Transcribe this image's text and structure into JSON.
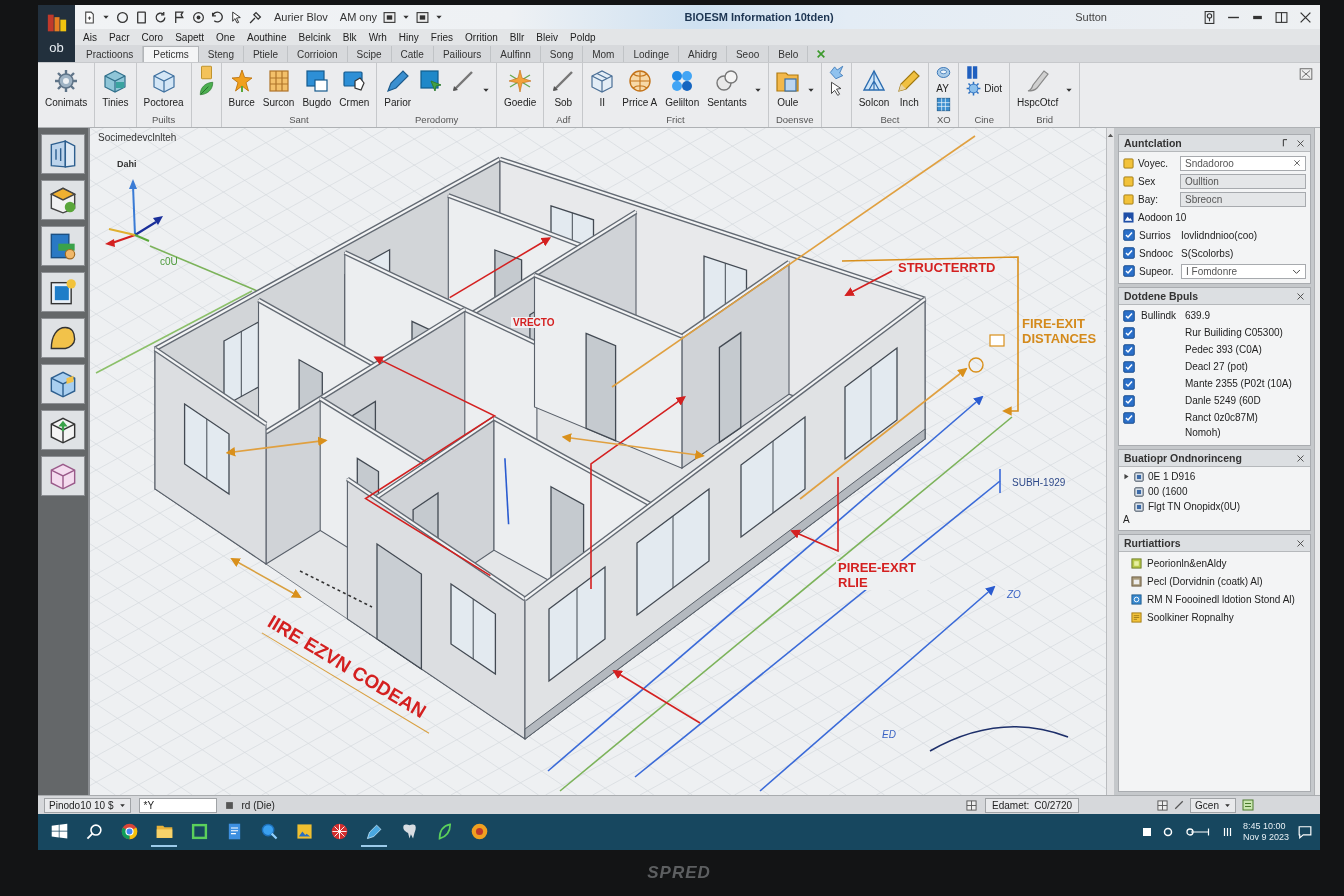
{
  "title_bar": {
    "app_label": "ob",
    "quick_access": [
      {
        "kind": "new"
      },
      {
        "kind": "caret"
      },
      {
        "kind": "circle"
      },
      {
        "kind": "page"
      },
      {
        "kind": "refresh"
      },
      {
        "kind": "flag"
      },
      {
        "kind": "target"
      },
      {
        "kind": "undo"
      },
      {
        "kind": "pointer"
      },
      {
        "kind": "tools"
      }
    ],
    "doc_labels": [
      "Aurier Blov",
      "AM ony"
    ],
    "view_tools": [
      {
        "kind": "box"
      },
      {
        "kind": "caret"
      },
      {
        "kind": "box"
      },
      {
        "kind": "caret"
      }
    ],
    "title": "BIOESM Information 10tden)",
    "user": "Sutton",
    "controls": [
      {
        "kind": "help"
      },
      {
        "kind": "minimize"
      },
      {
        "kind": "dash"
      },
      {
        "kind": "split"
      },
      {
        "kind": "close"
      }
    ]
  },
  "menu": [
    "Ais",
    "Pacr",
    "Coro",
    "Sapett",
    "One",
    "Aouthine",
    "Belcink",
    "Blk",
    "Wrh",
    "Hiny",
    "Fries",
    "Orrition",
    "Bllr",
    "Bleiv",
    "Poldp"
  ],
  "tabs": [
    {
      "label": "Practioons",
      "selected": false
    },
    {
      "label": "Peticms",
      "selected": true
    },
    {
      "label": "Steng",
      "selected": false
    },
    {
      "label": "Ptiele",
      "selected": false
    },
    {
      "label": "Corrioion",
      "selected": false
    },
    {
      "label": "Scipe",
      "selected": false
    },
    {
      "label": "Catle",
      "selected": false
    },
    {
      "label": "Pailiours",
      "selected": false
    },
    {
      "label": "Aulfinn",
      "selected": false
    },
    {
      "label": "Song",
      "selected": false
    },
    {
      "label": "Mom",
      "selected": false
    },
    {
      "label": "Lodinge",
      "selected": false
    },
    {
      "label": "Ahidrg",
      "selected": false
    },
    {
      "label": "Seoo",
      "selected": false
    },
    {
      "label": "Belo",
      "selected": false
    }
  ],
  "ribbon": {
    "groups": [
      {
        "buttons": [
          {
            "label": "Conimats",
            "kind": "large"
          }
        ]
      },
      {
        "buttons": [
          {
            "label": "Tinies",
            "kind": "large"
          }
        ]
      },
      {
        "label": "Puilts",
        "buttons": [
          {
            "label": "Poctorea",
            "kind": "large"
          }
        ]
      },
      {
        "buttons": [
          {
            "kind": "small"
          },
          {
            "kind": "small"
          }
        ]
      },
      {
        "label": "Sant",
        "buttons": [
          {
            "label": "Burce",
            "kind": "large"
          },
          {
            "label": "Surcon",
            "kind": "large"
          },
          {
            "label": "Bugdo",
            "kind": "large"
          },
          {
            "label": "Crmen",
            "kind": "large"
          }
        ]
      },
      {
        "label": "Perodomy",
        "buttons": [
          {
            "label": "Parior",
            "kind": "large"
          },
          {
            "kind": "large"
          },
          {
            "kind": "large"
          },
          {
            "kind": "caret"
          }
        ]
      },
      {
        "buttons": [
          {
            "label": "Goedie",
            "kind": "large"
          }
        ]
      },
      {
        "label": "Adf",
        "buttons": [
          {
            "label": "Sob",
            "kind": "large"
          }
        ]
      },
      {
        "label": "Frict",
        "buttons": [
          {
            "label": "II",
            "kind": "large"
          },
          {
            "label": "Prrice A",
            "kind": "large"
          },
          {
            "label": "Gelilton",
            "kind": "large"
          },
          {
            "label": "Sentants",
            "kind": "large"
          },
          {
            "kind": "caret"
          }
        ]
      },
      {
        "label": "Doensve",
        "buttons": [
          {
            "label": "Oule",
            "kind": "large"
          },
          {
            "kind": "caret"
          }
        ]
      },
      {
        "buttons": [
          {
            "kind": "small"
          },
          {
            "kind": "small"
          }
        ]
      },
      {
        "label": "Bect",
        "buttons": [
          {
            "label": "Solcon",
            "kind": "large"
          },
          {
            "label": "Inch",
            "kind": "large"
          }
        ]
      },
      {
        "label": "XO",
        "buttons": [
          {
            "kind": "small"
          },
          {
            "label": "AY",
            "kind": "small"
          },
          {
            "kind": "small"
          }
        ]
      },
      {
        "label": "Cine",
        "buttons": [
          {
            "kind": "small"
          },
          {
            "label": "Diot",
            "kind": "small"
          }
        ]
      },
      {
        "label": "Brid",
        "buttons": [
          {
            "label": "HspcOtcf",
            "kind": "large"
          },
          {
            "kind": "caret"
          }
        ]
      }
    ]
  },
  "tools": [
    {
      "kind": "door"
    },
    {
      "kind": "box"
    },
    {
      "kind": "panel"
    },
    {
      "kind": "frame"
    },
    {
      "kind": "dome"
    },
    {
      "kind": "cube"
    },
    {
      "kind": "cube-add"
    },
    {
      "kind": "cube-outline"
    }
  ],
  "viewport": {
    "title": "Socimedevclnlteh",
    "axis_label": "Dahi",
    "axis_note": "c0U",
    "annotations": [
      {
        "text": "STRUCTERRTD",
        "kind": "callout",
        "color": "#d42020"
      },
      {
        "text": "VRECTO",
        "kind": "tag",
        "color": "#d42020"
      },
      {
        "text": "FIRE-EXIT DISTANCES",
        "kind": "callout",
        "color": "#d48a1c"
      },
      {
        "text": "SUBH-1929",
        "kind": "tag",
        "color": "#2f4a8a"
      },
      {
        "text": "PIREE-EXRT RLIE",
        "kind": "callout",
        "color": "#d42020"
      },
      {
        "text": "ZO",
        "kind": "tag",
        "color": "#3a63c4"
      },
      {
        "text": "IIRE EZVN CODEAN",
        "kind": "banner",
        "color": "#d42020"
      },
      {
        "text": "ED",
        "kind": "tag",
        "color": "#3a63c4"
      }
    ]
  },
  "panels": [
    {
      "title": "Auntclation",
      "kind": "properties",
      "rows": [
        {
          "kind": "search",
          "label": "Voyec.",
          "value": "Sndadoroo"
        },
        {
          "kind": "field",
          "label": "Sex",
          "value": "Oulltion"
        },
        {
          "kind": "field",
          "label": "Bay:",
          "value": "Sbreocn"
        },
        {
          "kind": "info",
          "label": "Aodoon 10"
        },
        {
          "kind": "checkbox",
          "label": "Surrios",
          "value": "Iovlidndnioo(coo)",
          "checked": true
        },
        {
          "kind": "checkbox",
          "label": "Sndooc",
          "value": "S(Scolorbs)",
          "checked": true
        },
        {
          "kind": "dropdown",
          "label": "Supeor.",
          "value": "I Fomdonre",
          "checked": true
        }
      ]
    },
    {
      "title": "Dotdene Bpuls",
      "kind": "checklist",
      "items": [
        {
          "label": "Bullindk",
          "value": "639.9",
          "checked": true
        },
        {
          "value": "Rur Builiding C05300)",
          "checked": true
        },
        {
          "value": "Pedec 393 (C0A)",
          "checked": true
        },
        {
          "value": "Deacl 27 (pot)",
          "checked": true
        },
        {
          "value": "Mante 2355 (P02t (10A)",
          "checked": true
        },
        {
          "value": "Danle 5249 (60D",
          "checked": true
        },
        {
          "value": "Ranct 0z0c87M)",
          "checked": true
        }
      ],
      "footer": "Nomoh)"
    },
    {
      "title": "Buatiopr Ondnorinceng",
      "kind": "tree",
      "items": [
        {
          "kind": "branch",
          "label": "0E 1 D916"
        },
        {
          "kind": "leaf",
          "label": "00 (1600"
        },
        {
          "kind": "leaf",
          "label": "Flgt TN Onopidx(0U)"
        }
      ],
      "footer": "A"
    },
    {
      "title": "Rurtiattiors",
      "kind": "list",
      "items": [
        {
          "kind": "layer",
          "label": "Peorionln&enAldy"
        },
        {
          "kind": "sheet",
          "label": "Pecl (Dorvidnin (coatk) Al)"
        },
        {
          "kind": "model",
          "label": "RM N Foooinedl ldotion Stond Al)"
        },
        {
          "kind": "note",
          "label": "Soolkiner Ropnalhy"
        }
      ]
    }
  ],
  "status_bar": {
    "view": "Pinodo10 10 $",
    "input": "*Y",
    "mode": "rd (Die)",
    "coord_label": "Edamet:",
    "coord_value": "C0/2720",
    "scale": "Gcen"
  },
  "taskbar": {
    "apps": [
      {
        "kind": "start",
        "active": false
      },
      {
        "kind": "search",
        "active": false
      },
      {
        "kind": "browser",
        "active": false
      },
      {
        "kind": "folder",
        "active": true
      },
      {
        "kind": "store",
        "active": false
      },
      {
        "kind": "document",
        "active": false
      },
      {
        "kind": "magnifier",
        "active": false
      },
      {
        "kind": "photos",
        "active": false
      },
      {
        "kind": "media",
        "active": false
      },
      {
        "kind": "pen",
        "active": true
      },
      {
        "kind": "tooth",
        "active": false
      },
      {
        "kind": "leaf",
        "active": false
      },
      {
        "kind": "disc",
        "active": false
      }
    ],
    "time": "8:45 10:00",
    "date": "Nov 9 2023"
  },
  "monitor": {
    "brand": "SPRED"
  }
}
